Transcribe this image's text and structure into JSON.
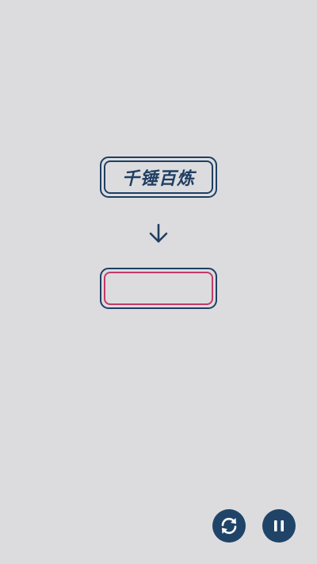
{
  "puzzle": {
    "word": "千锤百炼",
    "answer_value": ""
  },
  "controls": {
    "refresh_icon": "refresh-icon",
    "pause_icon": "pause-icon"
  },
  "colors": {
    "background": "#dcdcdf",
    "primary": "#1f3f62",
    "accent": "#c23a6a"
  }
}
